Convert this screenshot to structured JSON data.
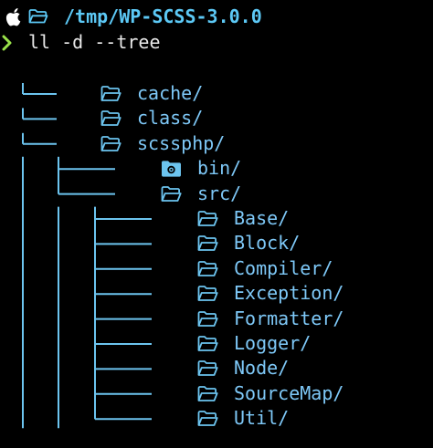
{
  "prompt": {
    "apple_icon": "apple-logo-icon",
    "folder_icon": "folder-open-icon",
    "path": "/tmp/WP-SCSS-3.0.0",
    "chevron_icon": "chevron-right-icon",
    "command": "ll -d --tree"
  },
  "tree": {
    "entries": [
      {
        "name": "cache/",
        "depth": 0,
        "icon": "folder-open-icon"
      },
      {
        "name": "class/",
        "depth": 0,
        "icon": "folder-open-icon"
      },
      {
        "name": "scssphp/",
        "depth": 0,
        "icon": "folder-open-icon"
      },
      {
        "name": "bin/",
        "depth": 1,
        "icon": "folder-gear-icon"
      },
      {
        "name": "src/",
        "depth": 1,
        "icon": "folder-open-icon"
      },
      {
        "name": "Base/",
        "depth": 2,
        "icon": "folder-open-icon"
      },
      {
        "name": "Block/",
        "depth": 2,
        "icon": "folder-open-icon"
      },
      {
        "name": "Compiler/",
        "depth": 2,
        "icon": "folder-open-icon"
      },
      {
        "name": "Exception/",
        "depth": 2,
        "icon": "folder-open-icon"
      },
      {
        "name": "Formatter/",
        "depth": 2,
        "icon": "folder-open-icon"
      },
      {
        "name": "Logger/",
        "depth": 2,
        "icon": "folder-open-icon"
      },
      {
        "name": "Node/",
        "depth": 2,
        "icon": "folder-open-icon"
      },
      {
        "name": "SourceMap/",
        "depth": 2,
        "icon": "folder-open-icon"
      },
      {
        "name": "Util/",
        "depth": 2,
        "icon": "folder-open-icon"
      }
    ]
  },
  "colors": {
    "background": "#000000",
    "path_text": "#5cc8f5",
    "entry_text": "#7ec8f7",
    "tree_lines": "#6cc4ef",
    "command_text": "#e9e9e9",
    "prompt_chevron": "#9ae24a"
  }
}
